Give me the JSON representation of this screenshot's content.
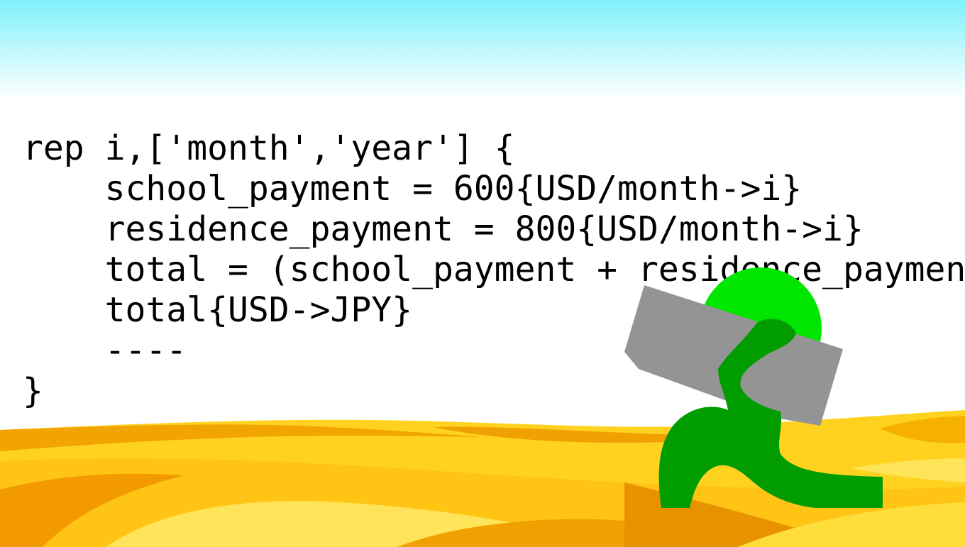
{
  "code": {
    "lines": [
      "rep i,['month','year'] {",
      "    school_payment = 600{USD/month->i}",
      "    residence_payment = 800{USD/month->i}",
      "    total = (school_payment + residence_payment)",
      "    total{USD->JPY}",
      "    ----",
      "}"
    ]
  },
  "colors": {
    "sky_top": "#7ff1fb",
    "sand_light": "#ffe04a",
    "sand_mid": "#ffc61a",
    "sand_dark": "#f0a000",
    "figure_body": "#009c00",
    "figure_head": "#00e600",
    "stone": "#949494",
    "text": "#000000"
  },
  "scene": {
    "icons": [
      "desert-dunes-illustration",
      "stone-carrier-figure-icon"
    ]
  }
}
